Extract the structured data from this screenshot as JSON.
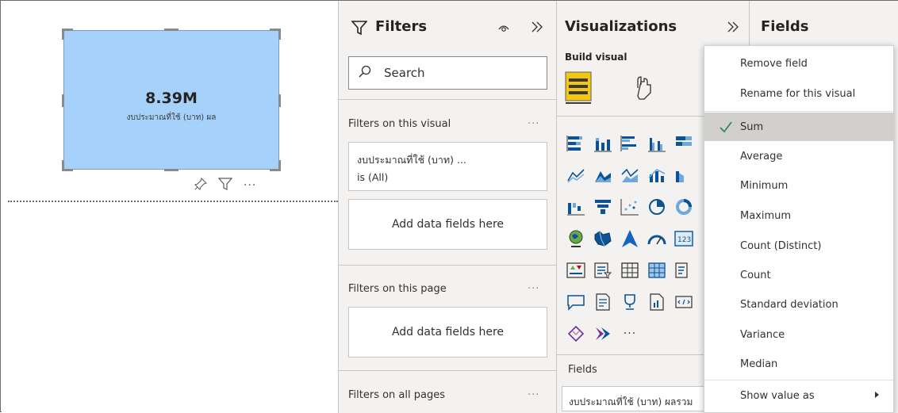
{
  "canvas": {
    "card_value": "8.39M",
    "card_label": "งบประมาณที่ใช้ (บาท) ผล"
  },
  "filters": {
    "title": "Filters",
    "search_placeholder": "Search",
    "on_visual_label": "Filters on this visual",
    "filter_card_title": "งบประมาณที่ใช้ (บาท) ...",
    "filter_card_value": "is (All)",
    "add_fields_1": "Add data fields here",
    "on_page_label": "Filters on this page",
    "add_fields_2": "Add data fields here",
    "on_all_pages_label": "Filters on all pages",
    "more": "···"
  },
  "visualizations": {
    "title": "Visualizations",
    "build_visual_label": "Build visual",
    "more_visuals": "···",
    "fields_label": "Fields",
    "field_well_value": "งบประมาณที่ใช้ (บาท) ผลรวม"
  },
  "fields_pane": {
    "title": "Fields"
  },
  "context_menu": {
    "items": [
      "Remove field",
      "Rename for this visual",
      "Sum",
      "Average",
      "Minimum",
      "Maximum",
      "Count (Distinct)",
      "Count",
      "Standard deviation",
      "Variance",
      "Median",
      "Show value as"
    ],
    "selected": "Sum"
  },
  "colors": {
    "card_fill": "#a5d1fb",
    "pane_bg": "#f3f2f1",
    "selected_row": "#d2d0ce",
    "check": "#2e8b57",
    "accent_yellow": "#f2c811"
  }
}
